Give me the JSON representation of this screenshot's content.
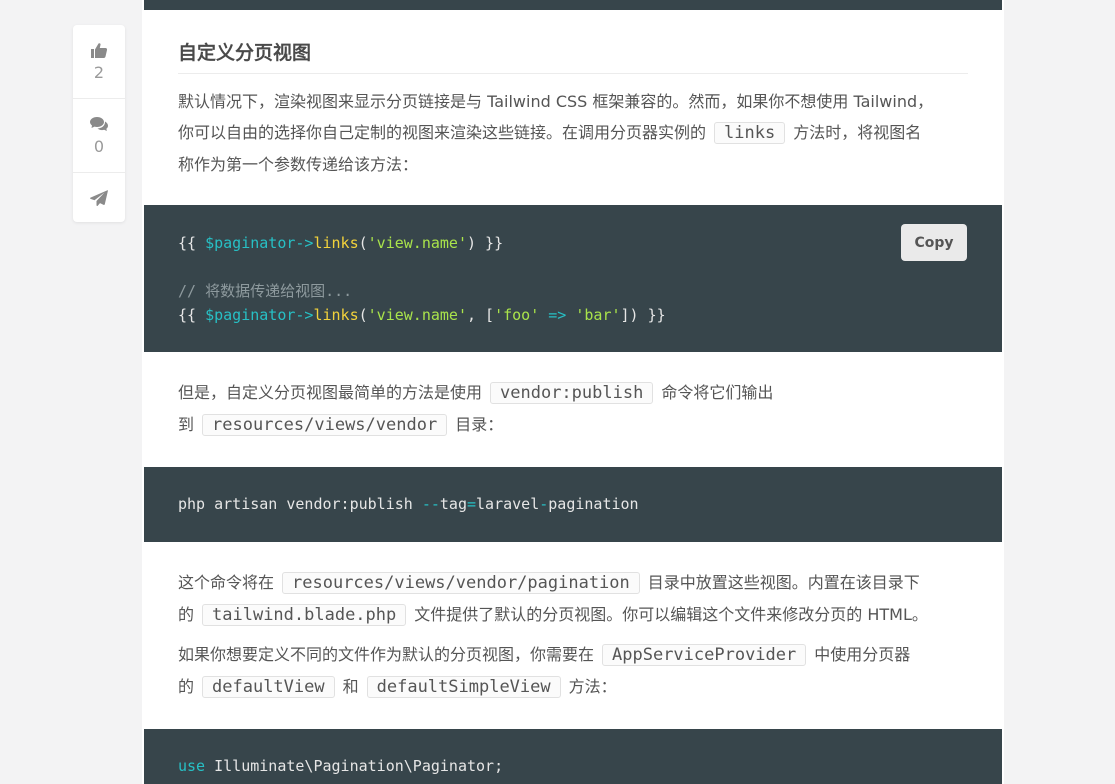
{
  "actions": {
    "like_count": "2",
    "comment_count": "0"
  },
  "article": {
    "heading": "自定义分页视图",
    "p1": {
      "t1": "默认情况下，渲染视图来显示分页链接是与 Tailwind CSS 框架兼容的。然而，如果你不想使用 Tailwind，",
      "t2": "你可以自由的选择你自己定制的视图来渲染这些链接。在调用分页器实例的",
      "code1": "links",
      "t3": "方法时，将视图名",
      "t4": "称作为第一个参数传递给该方法："
    },
    "code1": {
      "copy_label": "Copy",
      "l1": {
        "a": "{{ ",
        "var": "$paginator",
        "arrow": "->",
        "fn": "links",
        "b": "(",
        "str": "'view.name'",
        "c": ") }}"
      },
      "comment": "// 将数据传递给视图...",
      "l3": {
        "a": "{{ ",
        "var": "$paginator",
        "arrow": "->",
        "fn": "links",
        "b": "(",
        "str1": "'view.name'",
        "c": ", [",
        "str2": "'foo'",
        "arrow2": " => ",
        "str3": "'bar'",
        "d": "]) }}"
      }
    },
    "p2": {
      "t1": "但是，自定义分页视图最简单的方法是使用",
      "code1": "vendor:publish",
      "t2": "命令将它们输出",
      "t3": "到",
      "code2": "resources/views/vendor",
      "t4": "目录："
    },
    "code2": {
      "a": "php artisan vendor:publish ",
      "dash": "--",
      "b": "tag",
      "eq": "=",
      "c": "laravel",
      "dash2": "-",
      "d": "pagination"
    },
    "p3": {
      "t1": "这个命令将在",
      "code1": "resources/views/vendor/pagination",
      "t2": "目录中放置这些视图。内置在该目录下",
      "t3": "的",
      "code2": "tailwind.blade.php",
      "t4": "文件提供了默认的分页视图。你可以编辑这个文件来修改分页的 HTML。"
    },
    "p4": {
      "t1": "如果你想要定义不同的文件作为默认的分页视图，你需要在",
      "code1": "AppServiceProvider",
      "t2": "中使用分页器",
      "t3": "的",
      "code2": "defaultView",
      "t4": "和",
      "code3": "defaultSimpleView",
      "t5": "方法："
    },
    "code3": {
      "kw": "use",
      "rest": " Illuminate\\Pagination\\Paginator;"
    }
  }
}
